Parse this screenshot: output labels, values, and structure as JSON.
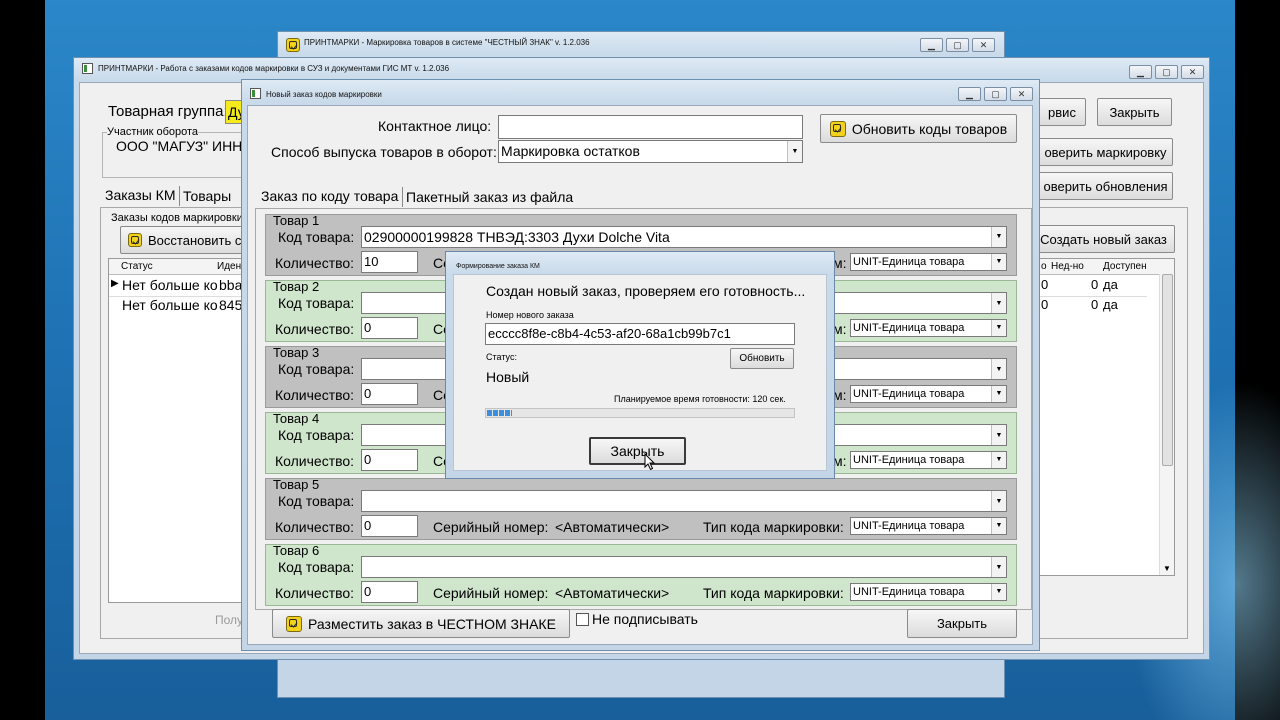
{
  "win_back": {
    "title": "ПРИНТМАРКИ - Маркировка товаров в системе \"ЧЕСТНЫЙ ЗНАК\"   v. 1.2.036"
  },
  "win_mid": {
    "title": "ПРИНТМАРКИ  -  Работа с заказами кодов маркировки в СУЗ и документами ГИС МТ    v. 1.2.036",
    "product_group_label": "Товарная группа:",
    "product_group_value": "Ду",
    "participant_label": "Участник оборота",
    "participant_value": "ООО \"МАГУЗ\"  ИНН",
    "service_btn": "рвис",
    "close_btn": "Закрыть",
    "check_marking_btn": "оверить маркировку",
    "check_updates_btn": "оверить обновления",
    "create_order_btn": "Создать новый заказ",
    "tabs": [
      "Заказы КМ",
      "Товары"
    ],
    "orders_group_label": "Заказы кодов маркировки",
    "restore_btn": "Восстановить с",
    "grid_headers_left": [
      "Статус",
      "Иден"
    ],
    "grid_rows_left": [
      [
        "Нет больше ко",
        "bba"
      ],
      [
        "Нет больше ко",
        "845"
      ]
    ],
    "grid_headers_right": [
      "о",
      "Нед-но",
      "Доступен"
    ],
    "grid_rows_right": [
      [
        "0",
        "0",
        "да"
      ],
      [
        "0",
        "0",
        "да"
      ]
    ],
    "bottom_faded": "Полу"
  },
  "win_new_order": {
    "title": "Новый заказ кодов маркировки",
    "contact_label": "Контактное лицо:",
    "contact_value": "",
    "release_label": "Способ выпуска товаров в оборот:",
    "release_value": "Маркировка остатков",
    "update_codes_btn": "Обновить коды товаров",
    "tabs": [
      "Заказ по коду товара",
      "Пакетный заказ из файла"
    ],
    "items": [
      {
        "header": "Товар 1",
        "code_label": "Код товара:",
        "code": "02900000199828 ТНВЭД:3303 Духи Dolche Vita",
        "qty_label": "Количество:",
        "qty": "10",
        "serial_label": "Се",
        "serial_value": "",
        "type_label": "м:",
        "type": "UNIT-Единица товара"
      },
      {
        "header": "Товар 2",
        "code_label": "Код товара:",
        "code": "",
        "qty_label": "Количество:",
        "qty": "0",
        "serial_label": "Се",
        "serial_value": "",
        "type_label": "м:",
        "type": "UNIT-Единица товара"
      },
      {
        "header": "Товар 3",
        "code_label": "Код товара:",
        "code": "",
        "qty_label": "Количество:",
        "qty": "0",
        "serial_label": "Се",
        "serial_value": "",
        "type_label": "м:",
        "type": "UNIT-Единица товара"
      },
      {
        "header": "Товар 4",
        "code_label": "Код товара:",
        "code": "",
        "qty_label": "Количество:",
        "qty": "0",
        "serial_label": "Се",
        "serial_value": "",
        "type_label": "м:",
        "type": "UNIT-Единица товара"
      },
      {
        "header": "Товар 5",
        "code_label": "Код товара:",
        "code": "",
        "qty_label": "Количество:",
        "qty": "0",
        "serial_label": "Серийный номер:",
        "serial_value": "<Автоматически>",
        "type_label": "Тип кода маркировки:",
        "type": "UNIT-Единица товара"
      },
      {
        "header": "Товар 6",
        "code_label": "Код товара:",
        "code": "",
        "qty_label": "Количество:",
        "qty": "0",
        "serial_label": "Серийный номер:",
        "serial_value": "<Автоматически>",
        "type_label": "Тип кода маркировки:",
        "type": "UNIT-Единица товара"
      }
    ],
    "place_order_btn": "Разместить заказ в ЧЕСТНОМ ЗНАКЕ",
    "no_sign_label": "Не подписывать",
    "no_sign_checked": false,
    "close_btn": "Закрыть"
  },
  "dialog": {
    "title": "Формирование заказа КМ",
    "message": "Создан новый заказ, проверяем его готовность...",
    "order_num_label": "Номер нового заказа",
    "order_num": "ecccc8f8e-c8b4-4c53-af20-68a1cb99b7c1",
    "status_label": "Статус:",
    "refresh_btn": "Обновить",
    "status_value": "Новый",
    "eta": "Планируемое время готовности: 120 сек.",
    "progress": 0.08,
    "close_btn": "Закрыть"
  },
  "colors": {
    "accent_yellow": "#f2d21c",
    "item_gray": "#c0c0c0",
    "item_green": "#cfe5cc",
    "progress": "#3b8fdc"
  }
}
